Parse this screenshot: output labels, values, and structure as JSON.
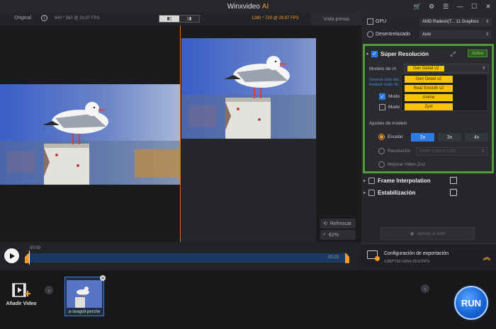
{
  "window": {
    "title": "Winxvideo",
    "title_accent": "AI",
    "controls": [
      "cart-icon",
      "gear-icon",
      "menu-icon",
      "minimize-icon",
      "maximize-icon",
      "close-icon"
    ]
  },
  "preview_header": {
    "original_label": "Original",
    "original_spec": "640 * 360 @ 29.97 FPS",
    "output_spec": "1280 * 720 @ 29.97 FPS",
    "vista_previa_label": "Vista previa"
  },
  "preview_tools": {
    "refresh_label": "Refrescar",
    "zoom_label": "62%"
  },
  "timeline": {
    "start_time": "00:00",
    "end_time": "00:23",
    "position": 0.0
  },
  "file_bar": {
    "add_video_label": "Añadir Video",
    "files": [
      {
        "name": "a-seagull-perche"
      }
    ],
    "run_label": "RUN"
  },
  "settings": {
    "gpu_label": "GPU",
    "gpu_value": "AMD Radeon(T... 11 Graphics",
    "deinterlace_label": "Desentrelazado",
    "deinterlace_value": "Auto",
    "super_resolution": {
      "title": "Súper Resolución",
      "status": "Activo",
      "model_label": "Modelo de IA",
      "model_value": "Gen Detail v2",
      "model_options": [
        "Gen Detail v2",
        "Real Smooth v2",
        "Anime",
        "Zyxt"
      ],
      "description": "Generar más det... Reducir ruido. M...",
      "mode_quality_label": "Modo",
      "mode_fast_label": "Modo rápido",
      "adjustments_label": "Ajustes de modelo",
      "scale_label": "Escalar",
      "scale_options": [
        "2x",
        "3x",
        "4x"
      ],
      "scale_selected": "2x",
      "resolution_label": "Resolución",
      "resolution_value": "1080P (1920 X 1080)",
      "improve_label": "Mejorar vídeo (1x)"
    },
    "frame_interpolation_label": "Frame Interpolation",
    "stabilization_label": "Estabilización",
    "apply_all_label": "Aplicar a todo",
    "export": {
      "title": "Configuración de exportación",
      "details": "1280*720  H264  29.97FPS"
    }
  }
}
